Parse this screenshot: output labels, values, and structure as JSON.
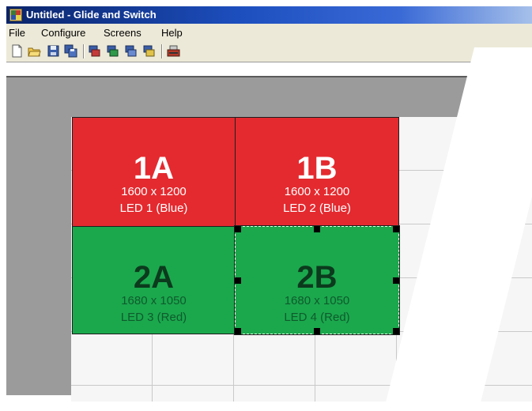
{
  "window": {
    "title": "Untitled - Glide and Switch"
  },
  "menu": [
    "File",
    "Configure",
    "Screens",
    "Help"
  ],
  "toolbar": {
    "buttons": [
      "new-file-icon",
      "open-folder-icon",
      "save-icon",
      "save-all-icon",
      "screen-tool-icon",
      "screen-tool-icon",
      "screen-tool-icon",
      "screen-tool-icon",
      "hardware-icon"
    ]
  },
  "screens": [
    {
      "name": "1A",
      "resolution": "1600 x 1200",
      "led": "LED 1 (Blue)",
      "color": "#e42a2f"
    },
    {
      "name": "1B",
      "resolution": "1600 x 1200",
      "led": "LED 2 (Blue)",
      "color": "#e42a2f"
    },
    {
      "name": "2A",
      "resolution": "1680 x 1050",
      "led": "LED 3 (Red)",
      "color": "#1ba84d"
    },
    {
      "name": "2B",
      "resolution": "1680 x 1050",
      "led": "LED 4 (Red)",
      "color": "#1ba84d",
      "selected": true
    }
  ],
  "colors": {
    "titlebar": "#0a246a",
    "workspace": "#9b9b9b",
    "grid": "#f6f6f6"
  }
}
